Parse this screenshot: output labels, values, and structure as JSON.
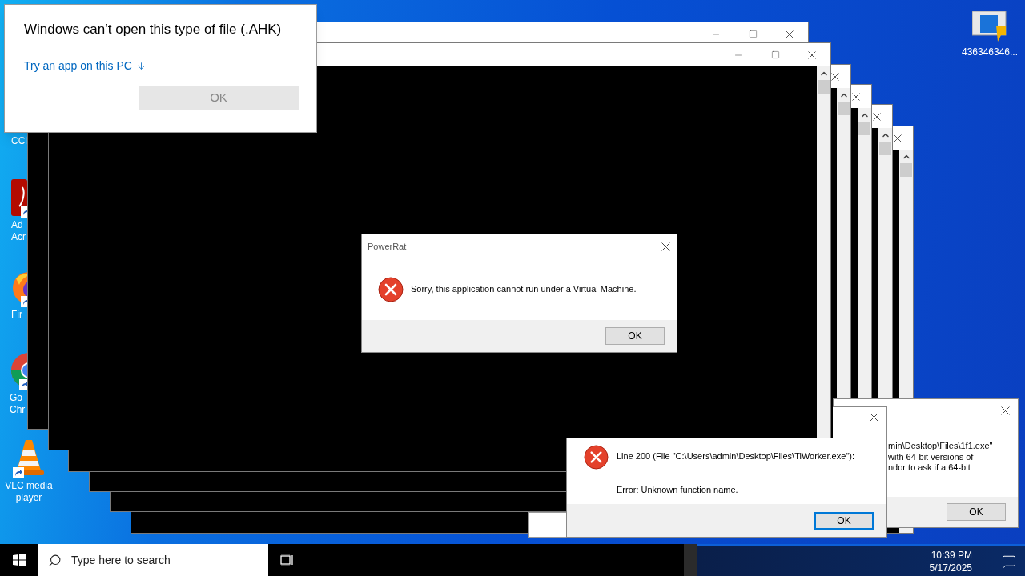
{
  "desktop_icons": [
    {
      "lines": [
        "CCl"
      ]
    },
    {
      "lines": [
        "Ad",
        "Acr"
      ]
    },
    {
      "lines": [
        "Fir"
      ]
    },
    {
      "lines": [
        "Go",
        "Chr"
      ]
    },
    {
      "lines": [
        "VLC media",
        "player"
      ]
    },
    {
      "lines": [
        "436346346..."
      ]
    }
  ],
  "open_with_dialog": {
    "title": "Windows can’t open this type of file (.AHK)",
    "link": "Try an app on this PC",
    "ok_button": {
      "label": "OK",
      "disabled": true
    }
  },
  "powerrat_dialog": {
    "title": "PowerRat",
    "message": "Sorry, this application cannot run under a Virtual Machine.",
    "ok_button": {
      "label": "OK",
      "focused": false
    }
  },
  "script_error_dialog": {
    "lines": [
      "Line 200  (File \"C:\\Users\\admin\\Desktop\\Files\\TiWorker.exe\"):",
      "Error: Unknown function name."
    ],
    "ok_button": {
      "label": "OK",
      "focused": true
    }
  },
  "background_dialog": {
    "lines": [
      "min\\Desktop\\Files\\1f1.exe\"",
      "with 64-bit versions of",
      "ndor to ask if a 64-bit"
    ],
    "ok_button": {
      "label": "OK",
      "focused": false
    }
  },
  "taskbar": {
    "search": {
      "placeholder": "Type here to search"
    },
    "time": "10:39 PM",
    "date": "5/17/2025"
  }
}
